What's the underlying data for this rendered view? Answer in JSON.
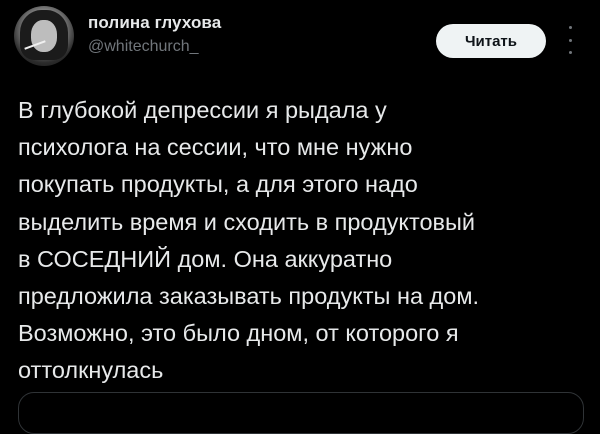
{
  "author": {
    "name": "полина глухова",
    "handle": "@whitechurch_",
    "avatar_icon": "profile-photo"
  },
  "header": {
    "follow_label": "Читать",
    "more_icon": "vertical-ellipsis-icon"
  },
  "tweet": {
    "lines": [
      "В глубокой депрессии я рыдала у",
      "психолога на сессии, что мне нужно",
      "покупать продукты, а для этого надо",
      "выделить время и сходить в продуктовый",
      "в СОСЕДНИЙ дом. Она аккуратно",
      "предложила заказывать продукты на дом.",
      "Возможно, это было дном, от которого я",
      "оттолкнулась"
    ]
  },
  "colors": {
    "background": "#000000",
    "text": "#e7e9ea",
    "secondary_text": "#71767b",
    "button_bg": "#eff3f4"
  }
}
